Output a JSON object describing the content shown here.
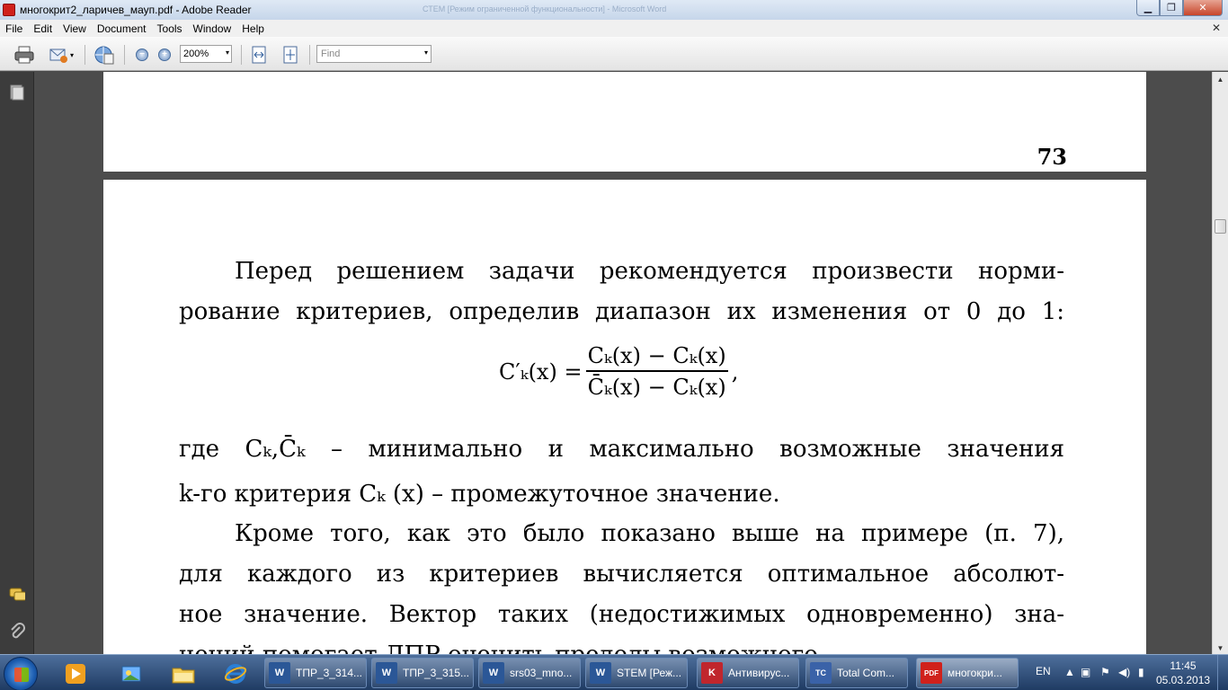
{
  "window": {
    "title": "многокрит2_ларичев_мауп.pdf - Adobe Reader",
    "ghost_text": "СТЕМ [Режим ограниченной функциональности] - Microsoft Word",
    "min_glyph": "▁",
    "max_glyph": "❐",
    "close_glyph": "✕"
  },
  "menu": {
    "items": [
      "File",
      "Edit",
      "View",
      "Document",
      "Tools",
      "Window",
      "Help"
    ],
    "close_glyph": "✕"
  },
  "toolbar": {
    "zoom_value": "200%",
    "find_placeholder": "Find",
    "dropdown_glyph": "▾",
    "zoom_out_glyph": "−",
    "zoom_in_glyph": "+"
  },
  "document": {
    "page_number": "73",
    "paragraph1": [
      "Перед решением задачи рекомендуется произвести норми-",
      "рование критериев, определив диапазон их изменения от 0 до 1:"
    ],
    "formula": {
      "lhs": "C′ₖ(x) =",
      "numerator": "Cₖ(x) − Cₖ(x)",
      "denominator": "C̄ₖ(x) − Cₖ(x)",
      "tail": ","
    },
    "paragraph2": [
      "где  Cₖ,C̄ₖ –  минимально  и максимально возможные значения",
      "k-го критерия Cₖ (x) – промежуточное значение."
    ],
    "paragraph3": [
      "Кроме того, как это было показано выше на примере (п. 7),",
      "для каждого из критериев вычисляется оптимальное абсолют-",
      "ное значение. Вектор таких (недостижимых одновременно) зна-",
      "чений помогает ЛПР оценить пределы возможного."
    ]
  },
  "nav_icons": [
    "pages-icon",
    "comments-icon",
    "attachments-icon"
  ],
  "taskbar": {
    "tasks": [
      {
        "label": "ТПР_3_314...",
        "icon": "W",
        "color": "#2b5797"
      },
      {
        "label": "ТПР_3_315...",
        "icon": "W",
        "color": "#2b5797"
      },
      {
        "label": "srs03_mno...",
        "icon": "W",
        "color": "#2b5797"
      },
      {
        "label": "STEM [Реж...",
        "icon": "W",
        "color": "#2b5797"
      },
      {
        "label": "Антивирус...",
        "icon": "K",
        "color": "#c0262d"
      },
      {
        "label": "Total Com...",
        "icon": "TC",
        "color": "#3a62a8"
      },
      {
        "label": "многокри...",
        "icon": "PDF",
        "color": "#d0211b"
      }
    ],
    "language": "EN",
    "time": "11:45",
    "date": "05.03.2013"
  },
  "colors": {
    "doc_background": "#4c4c4c",
    "page": "#ffffff",
    "taskbar": "#1f3b63",
    "adobe_red": "#d0211b"
  }
}
